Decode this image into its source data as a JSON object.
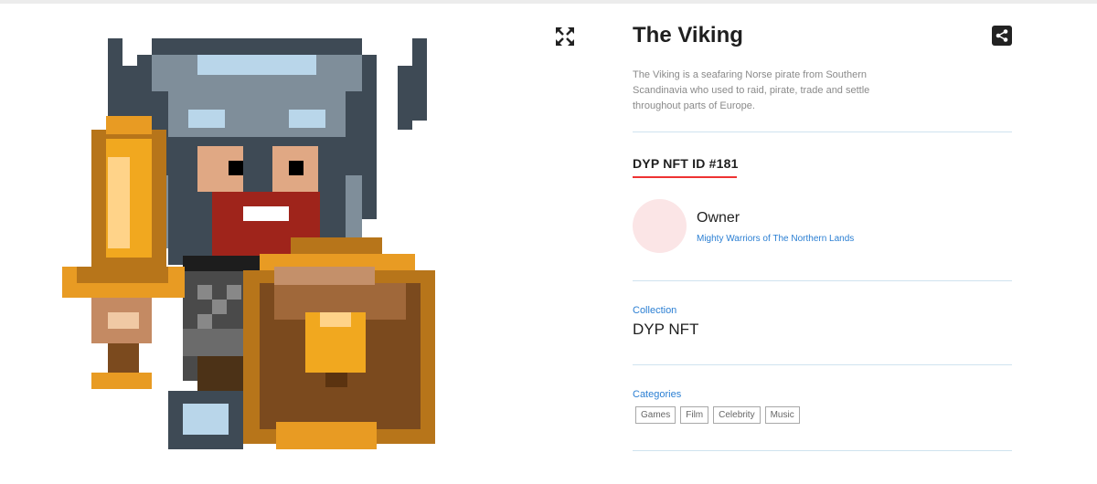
{
  "nft": {
    "title": "The Viking",
    "description": "The Viking is a seafaring Norse pirate from Southern Scandinavia who used to raid, pirate, trade and settle throughout parts of Europe.",
    "id_label": "DYP NFT ID #181"
  },
  "owner": {
    "label": "Owner",
    "name": "Mighty Warriors of The Northern Lands"
  },
  "collection": {
    "label": "Collection",
    "value": "DYP NFT"
  },
  "categories": {
    "label": "Categories",
    "items": [
      "Games",
      "Film",
      "Celebrity",
      "Music"
    ]
  },
  "icons": {
    "expand": "expand-icon",
    "share": "share-icon"
  },
  "colors": {
    "accent_underline": "#e33333",
    "link": "#2b7fd3",
    "divider": "#cfe3ef",
    "avatar_bg": "#fbe5e6"
  }
}
